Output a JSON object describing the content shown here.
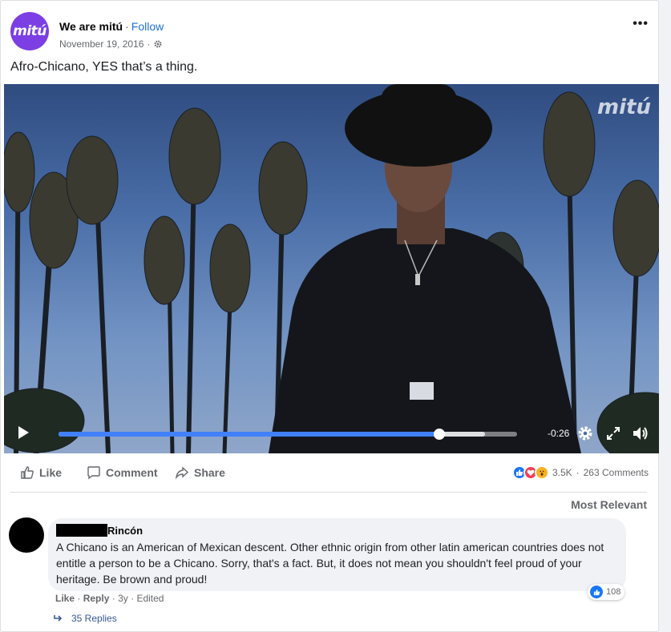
{
  "page": {
    "avatar_text": "mitú",
    "name": "We are mitú",
    "separator": "·",
    "follow_label": "Follow",
    "date": "November 19, 2016",
    "meta_sep": "·",
    "more_label": "•••",
    "post_text": "Afro-Chicano, YES that’s a thing."
  },
  "video": {
    "watermark": "mitú",
    "time_remaining": "-0:26",
    "progress_played": 0.83,
    "progress_buffered": 0.93,
    "icons": [
      "play-icon",
      "gear-icon",
      "fullscreen-icon",
      "volume-icon"
    ]
  },
  "actions": {
    "like_label": "Like",
    "comment_label": "Comment",
    "share_label": "Share",
    "reaction_count": "3.5K",
    "dot": "·",
    "comments_count": "263 Comments"
  },
  "comments_filter": "Most Relevant",
  "comment": {
    "name": "Rincón",
    "text": "A Chicano is an American of Mexican descent. Other ethnic origin from other latin american countries does not entitle a person to be a Chicano. Sorry, that's a fact. But, it does not mean you shouldn't feel proud of your heritage. Be brown and proud!",
    "like_label": "Like",
    "reply_label": "Reply",
    "age": "3y",
    "edited": "Edited",
    "sep": "·",
    "likes": "108",
    "replies_label": "35 Replies"
  },
  "colors": {
    "accent": "#216fdb",
    "brand": "#7b3fe4",
    "progress": "#4080ff"
  }
}
